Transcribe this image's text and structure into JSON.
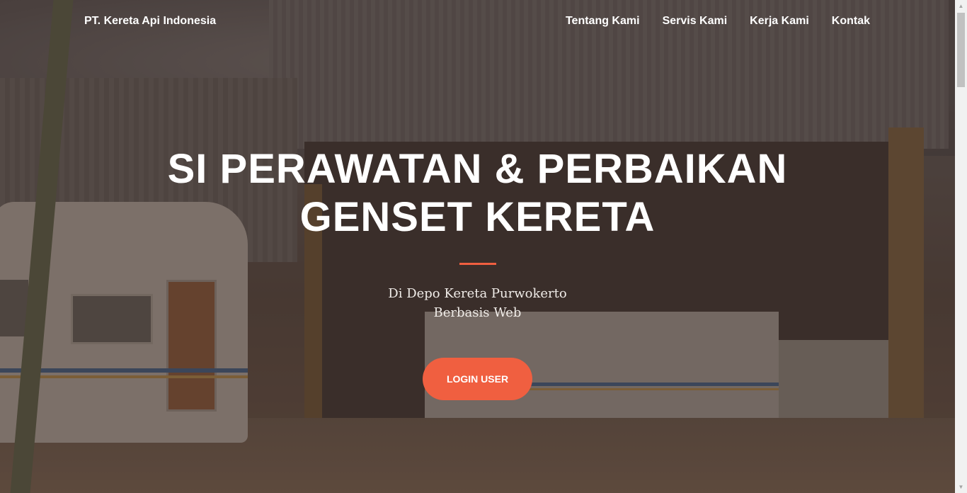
{
  "navbar": {
    "brand": "PT. Kereta Api Indonesia",
    "links": [
      "Tentang Kami",
      "Servis Kami",
      "Kerja Kami",
      "Kontak"
    ]
  },
  "hero": {
    "title_line1": "SI PERAWATAN & PERBAIKAN",
    "title_line2": "GENSET KERETA",
    "subtitle_line1": "Di Depo Kereta Purwokerto",
    "subtitle_line2": "Berbasis Web",
    "button_label": "LOGIN USER"
  },
  "colors": {
    "accent": "#f05f40",
    "text": "#ffffff"
  },
  "icons": {
    "scroll_up": "scroll-up-arrow-icon",
    "scroll_down": "scroll-down-arrow-icon"
  }
}
